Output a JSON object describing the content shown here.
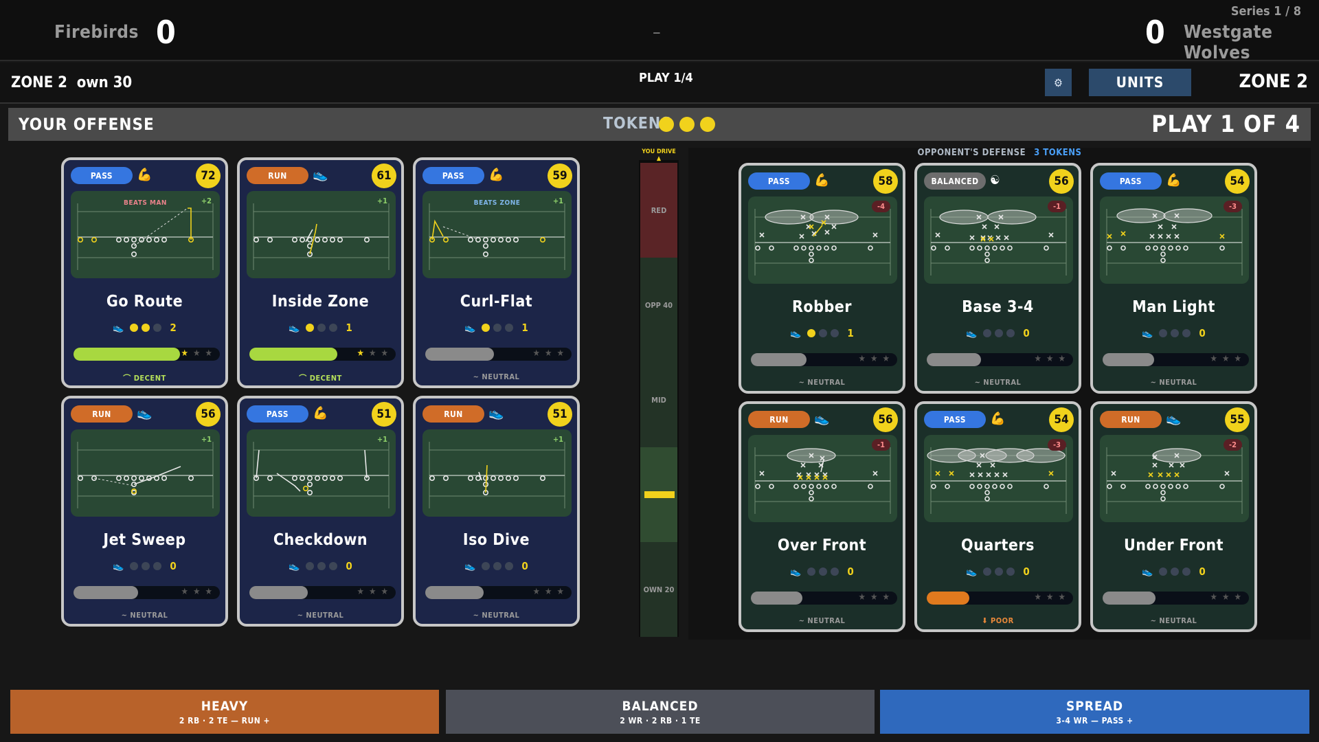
{
  "scoreboard": {
    "home_team": "Firebirds",
    "home_score": "0",
    "separator": "–",
    "away_score": "0",
    "away_team": "Westgate Wolves",
    "series": "Series 1 / 8"
  },
  "infobar": {
    "zone_left": "ZONE 2",
    "field_position": "own 30",
    "play": "PLAY 1/4",
    "gear": "⚙",
    "units": "UNITS",
    "zone_right": "ZONE 2"
  },
  "offense_bar": {
    "title": "YOUR OFFENSE",
    "tokens_label": "TOKENS",
    "tokens_count": 3,
    "play_of": "PLAY 1 OF 4"
  },
  "drive": {
    "label": "YOU DRIVE ▲",
    "zones": [
      {
        "label": "RED",
        "color": "#5a2426"
      },
      {
        "label": "OPP 40",
        "color": "#233326"
      },
      {
        "label": "MID",
        "color": "#233326"
      },
      {
        "label": "",
        "color": "#304c31"
      },
      {
        "label": "OWN 20",
        "color": "#233326"
      }
    ],
    "ball_zone": 3
  },
  "defense_header": {
    "title": "OPPONENT'S DEFENSE",
    "tokens": "3 TOKENS"
  },
  "offense_cards": [
    {
      "type": "PASS",
      "icon": "💪",
      "rating": "72",
      "mod": "+2",
      "note": "BEATS MAN",
      "note_color": "#e9828a",
      "name": "Go Route",
      "cost_on": 2,
      "cost": "2",
      "meter": 0.73,
      "meter_color": "#a8d840",
      "stars": 1,
      "verdict": "⌒ DECENT",
      "verdict_color": "#b5e05a",
      "play": "go"
    },
    {
      "type": "RUN",
      "icon": "👟",
      "rating": "61",
      "mod": "+1",
      "note": "",
      "note_color": "#fff",
      "name": "Inside Zone",
      "cost_on": 1,
      "cost": "1",
      "meter": 0.6,
      "meter_color": "#a8d840",
      "stars": 1,
      "verdict": "⌒ DECENT",
      "verdict_color": "#b5e05a",
      "play": "iz"
    },
    {
      "type": "PASS",
      "icon": "💪",
      "rating": "59",
      "mod": "+1",
      "note": "BEATS ZONE",
      "note_color": "#7fb6ea",
      "name": "Curl-Flat",
      "cost_on": 1,
      "cost": "1",
      "meter": 0.47,
      "meter_color": "#8a8a8a",
      "stars": 0,
      "verdict": "~ NEUTRAL",
      "verdict_color": "#9a9a9a",
      "play": "curl"
    },
    {
      "type": "RUN",
      "icon": "👟",
      "rating": "56",
      "mod": "+1",
      "note": "",
      "note_color": "#fff",
      "name": "Jet Sweep",
      "cost_on": 0,
      "cost": "0",
      "meter": 0.44,
      "meter_color": "#8a8a8a",
      "stars": 0,
      "verdict": "~ NEUTRAL",
      "verdict_color": "#9a9a9a",
      "play": "jet"
    },
    {
      "type": "PASS",
      "icon": "💪",
      "rating": "51",
      "mod": "+1",
      "note": "",
      "note_color": "#fff",
      "name": "Checkdown",
      "cost_on": 0,
      "cost": "0",
      "meter": 0.4,
      "meter_color": "#8a8a8a",
      "stars": 0,
      "verdict": "~ NEUTRAL",
      "verdict_color": "#9a9a9a",
      "play": "check"
    },
    {
      "type": "RUN",
      "icon": "👟",
      "rating": "51",
      "mod": "+1",
      "note": "",
      "note_color": "#fff",
      "name": "Iso Dive",
      "cost_on": 0,
      "cost": "0",
      "meter": 0.4,
      "meter_color": "#8a8a8a",
      "stars": 0,
      "verdict": "~ NEUTRAL",
      "verdict_color": "#9a9a9a",
      "play": "iso"
    }
  ],
  "defense_cards": [
    {
      "type": "PASS",
      "icon": "💪",
      "rating": "58",
      "mod": "-4",
      "note": "",
      "name": "Robber",
      "cost_on": 1,
      "cost": "1",
      "meter": 0.38,
      "meter_color": "#8a8a8a",
      "stars": 0,
      "verdict": "~ NEUTRAL",
      "verdict_color": "#9a9a9a",
      "play": "robber"
    },
    {
      "type": "BALANCED",
      "icon": "☯",
      "rating": "56",
      "mod": "-1",
      "note": "",
      "name": "Base 3-4",
      "cost_on": 0,
      "cost": "0",
      "meter": 0.37,
      "meter_color": "#8a8a8a",
      "stars": 0,
      "verdict": "~ NEUTRAL",
      "verdict_color": "#9a9a9a",
      "play": "base34"
    },
    {
      "type": "PASS",
      "icon": "💪",
      "rating": "54",
      "mod": "-3",
      "note": "",
      "name": "Man Light",
      "cost_on": 0,
      "cost": "0",
      "meter": 0.35,
      "meter_color": "#8a8a8a",
      "stars": 0,
      "verdict": "~ NEUTRAL",
      "verdict_color": "#9a9a9a",
      "play": "manlight"
    },
    {
      "type": "RUN",
      "icon": "👟",
      "rating": "56",
      "mod": "-1",
      "note": "",
      "name": "Over Front",
      "cost_on": 0,
      "cost": "0",
      "meter": 0.35,
      "meter_color": "#8a8a8a",
      "stars": 0,
      "verdict": "~ NEUTRAL",
      "verdict_color": "#9a9a9a",
      "play": "over"
    },
    {
      "type": "PASS",
      "icon": "💪",
      "rating": "54",
      "mod": "-3",
      "note": "",
      "name": "Quarters",
      "cost_on": 0,
      "cost": "0",
      "meter": 0.29,
      "meter_color": "#e07a1e",
      "stars": 0,
      "verdict": "⬇ POOR",
      "verdict_color": "#e8883a",
      "play": "quarters"
    },
    {
      "type": "RUN",
      "icon": "👟",
      "rating": "55",
      "mod": "-2",
      "note": "",
      "name": "Under Front",
      "cost_on": 0,
      "cost": "0",
      "meter": 0.36,
      "meter_color": "#8a8a8a",
      "stars": 0,
      "verdict": "~ NEUTRAL",
      "verdict_color": "#9a9a9a",
      "play": "under"
    }
  ],
  "formations": [
    {
      "label": "HEAVY",
      "sub": "2 RB · 2 TE — RUN +",
      "color": "#b8622a"
    },
    {
      "label": "BALANCED",
      "sub": "2 WR · 2 RB · 1 TE",
      "color": "#4c4f58"
    },
    {
      "label": "SPREAD",
      "sub": "3-4 WR — PASS +",
      "color": "#2f69bd"
    }
  ]
}
